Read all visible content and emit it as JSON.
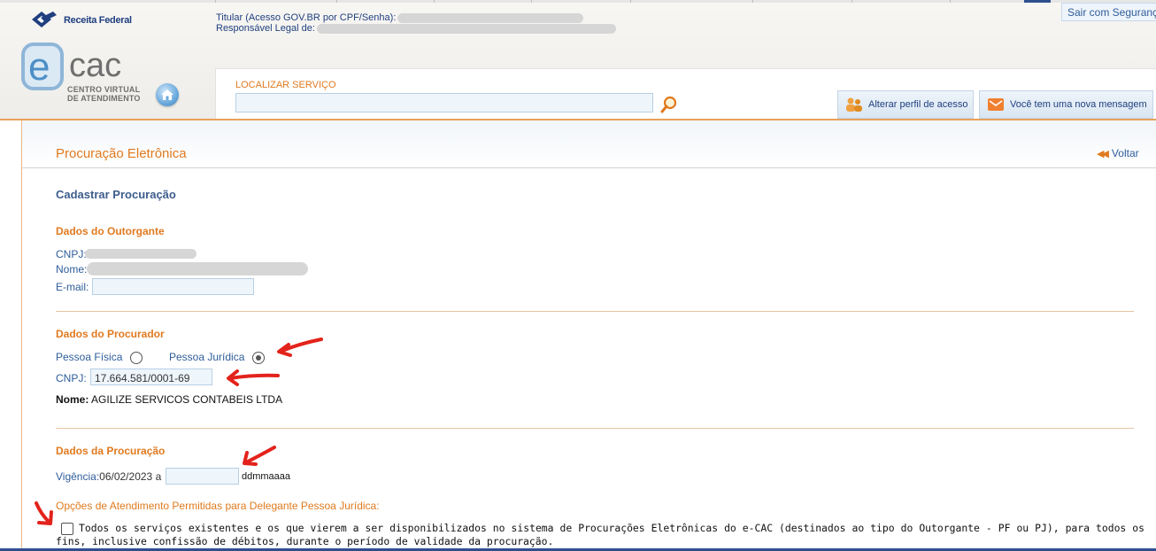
{
  "header": {
    "brand": "Receita Federal",
    "ecac_subtitle_1": "CENTRO VIRTUAL",
    "ecac_subtitle_2": "DE ATENDIMENTO",
    "titular_label": "Titular (Acesso GOV.BR por CPF/Senha):",
    "responsavel_label": "Responsável Legal de:",
    "logout_label": "Sair com Segurança",
    "search_label": "LOCALIZAR SERVIÇO",
    "search_value": "",
    "profile_button": "Alterar perfil de acesso",
    "message_button": "Você tem uma nova mensagem",
    "accent_color": "#e07a1f",
    "link_color": "#2e5d9a"
  },
  "page": {
    "title": "Procuração Eletrônica",
    "back_label": "Voltar",
    "subtitle": "Cadastrar Procuração"
  },
  "outorgante": {
    "section_title": "Dados do Outorgante",
    "cnpj_label": "CNPJ:",
    "nome_label": "Nome:",
    "email_label": "E-mail:",
    "email_value": ""
  },
  "procurador": {
    "section_title": "Dados do Procurador",
    "pf_label": "Pessoa Física",
    "pj_label": "Pessoa Jurídica",
    "selected": "Pessoa Jurídica",
    "cnpj_label": "CNPJ:",
    "cnpj_value": "17.664.581/0001-69",
    "nome_label": "Nome:",
    "nome_value": "AGILIZE SERVICOS CONTABEIS LTDA"
  },
  "procuracao": {
    "section_title": "Dados da Procuração",
    "vigencia_label": "Vigência:",
    "start_date": "06/02/2023",
    "separator": "a",
    "end_date": "",
    "date_hint": "ddmmaaaa"
  },
  "opcoes": {
    "title": "Opções de Atendimento Permitidas para Delegante Pessoa Jurídica:",
    "all_services_checked": false,
    "all_services_text": "Todos os serviços existentes e os que vierem a ser disponibilizados no sistema de Procurações Eletrônicas do e-CAC (destinados ao tipo do Outorgante - PF ou PJ), para todos os fins, inclusive confissão de débitos, durante o período de validade da procuração."
  }
}
